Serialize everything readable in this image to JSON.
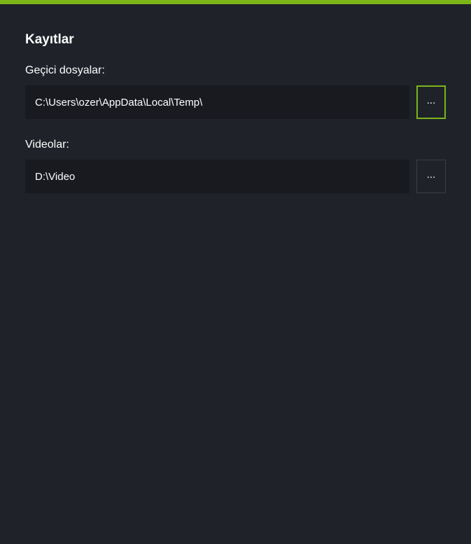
{
  "accent_color": "#7cb518",
  "section": {
    "title": "Kayıtlar"
  },
  "fields": {
    "temp": {
      "label": "Geçici dosyalar:",
      "value": "C:\\Users\\ozer\\AppData\\Local\\Temp\\",
      "browse_label": "...",
      "active": true
    },
    "videos": {
      "label": "Videolar:",
      "value": "D:\\Video",
      "browse_label": "...",
      "active": false
    }
  }
}
